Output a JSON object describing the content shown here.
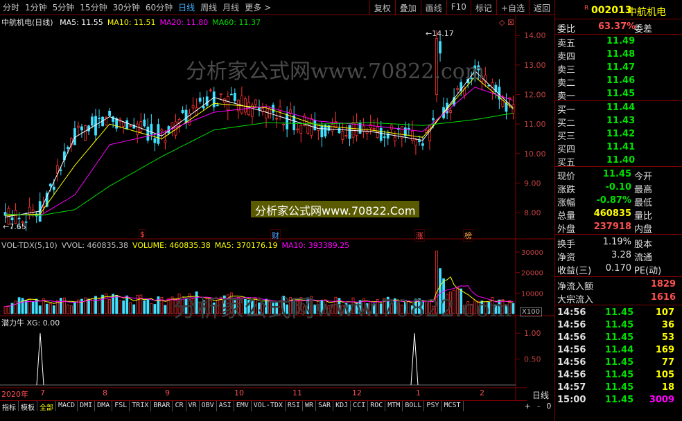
{
  "toolbar": {
    "timeframes": [
      "分时",
      "1分钟",
      "5分钟",
      "15分钟",
      "30分钟",
      "60分钟",
      "日线",
      "周线",
      "月线",
      "更多"
    ],
    "active": "日线",
    "more_arrow": ">",
    "right_buttons": [
      "复权",
      "叠加",
      "画线",
      "F10",
      "标记",
      "+自选",
      "返回"
    ]
  },
  "stock": {
    "badge": "R",
    "code": "002013",
    "name": "中航机电"
  },
  "main_chart": {
    "legend_title": "中航机电(日线)",
    "ma": [
      {
        "label": "MA5: 11.55",
        "color": "#ffffff"
      },
      {
        "label": "MA10: 11.51",
        "color": "#ffff00"
      },
      {
        "label": "MA20: 11.80",
        "color": "#ff00ff"
      },
      {
        "label": "MA60: 11.37",
        "color": "#00e000"
      }
    ],
    "high_label": "14.17",
    "low_label": "7.65",
    "diamonds": "◇ ☒",
    "events": [
      {
        "label": "$",
        "color": "#ff4040"
      },
      {
        "label": "财",
        "color": "#4aa0ff"
      },
      {
        "label": "涨",
        "color": "#ff4040"
      },
      {
        "label": "榜",
        "color": "#ffa040"
      }
    ]
  },
  "watermark": {
    "main": "分析家公式网www.70822.com",
    "badge": "分析家公式网www.70822.Com"
  },
  "vol_chart": {
    "legend": [
      {
        "label": "VOL-TDX(5,10)",
        "color": "#c0c0c0"
      },
      {
        "label": "VVOL: 460835.38",
        "color": "#c0c0c0"
      },
      {
        "label": "VOLUME: 460835.38",
        "color": "#ffff00"
      },
      {
        "label": "MA5: 370176.19",
        "color": "#ffff00"
      },
      {
        "label": "MA10: 393389.25",
        "color": "#ff00ff"
      }
    ],
    "scale_tag": "X100"
  },
  "ind_chart": {
    "legend": "潜力牛  XG: 0.00"
  },
  "date_axis": {
    "year_label": "2020年",
    "month_labels": [
      "7",
      "8",
      "9",
      "10",
      "11",
      "12",
      "1",
      "2"
    ]
  },
  "bottom_tabs": [
    "指标",
    "模板",
    "全部",
    "MACD",
    "DMI",
    "DMA",
    "FSL",
    "TRIX",
    "BRAR",
    "CR",
    "VR",
    "OBV",
    "ASI",
    "EMV",
    "VOL-TDX",
    "RSI",
    "WR",
    "SAR",
    "KDJ",
    "CCI",
    "ROC",
    "MTM",
    "BOLL",
    "PSY",
    "MCST"
  ],
  "bottom_active": "全部",
  "period_label": "日线",
  "bottom_controls": [
    "+",
    "-",
    "0"
  ],
  "order_book": {
    "ratio": {
      "label": "委比",
      "value": "63.37%",
      "label2": "委差"
    },
    "asks": [
      {
        "label": "卖五",
        "price": "11.49"
      },
      {
        "label": "卖四",
        "price": "11.48"
      },
      {
        "label": "卖三",
        "price": "11.47"
      },
      {
        "label": "卖二",
        "price": "11.46"
      },
      {
        "label": "卖一",
        "price": "11.45"
      }
    ],
    "bids": [
      {
        "label": "买一",
        "price": "11.44"
      },
      {
        "label": "买二",
        "price": "11.43"
      },
      {
        "label": "买三",
        "price": "11.42"
      },
      {
        "label": "买四",
        "price": "11.41"
      },
      {
        "label": "买五",
        "price": "11.40"
      }
    ]
  },
  "quote": [
    {
      "label": "现价",
      "value": "11.45",
      "label2": "今开",
      "color": "#00e000"
    },
    {
      "label": "涨跌",
      "value": "-0.10",
      "label2": "最高",
      "color": "#00e000"
    },
    {
      "label": "涨幅",
      "value": "-0.87%",
      "label2": "最低",
      "color": "#00e000"
    },
    {
      "label": "总量",
      "value": "460835",
      "label2": "量比",
      "color": "#ffff00"
    },
    {
      "label": "外盘",
      "value": "237918",
      "label2": "内盘",
      "color": "#ff5050"
    }
  ],
  "stats": [
    {
      "label": "换手",
      "value": "1.19%",
      "label2": "股本"
    },
    {
      "label": "净资",
      "value": "3.28",
      "label2": "流通"
    },
    {
      "label": "收益(三)",
      "value": "0.170",
      "label2": "PE(动)"
    }
  ],
  "flows": [
    {
      "label": "净流入额",
      "value": "1829"
    },
    {
      "label": "大宗流入",
      "value": "1616"
    }
  ],
  "ticks": [
    {
      "time": "14:56",
      "price": "11.45",
      "vol": "107",
      "vcolor": "#ffff00"
    },
    {
      "time": "14:56",
      "price": "11.45",
      "vol": "36",
      "vcolor": "#ffff00"
    },
    {
      "time": "14:56",
      "price": "11.45",
      "vol": "53",
      "vcolor": "#ffff00"
    },
    {
      "time": "14:56",
      "price": "11.44",
      "vol": "169",
      "vcolor": "#ffff00"
    },
    {
      "time": "14:56",
      "price": "11.45",
      "vol": "77",
      "vcolor": "#ffff00"
    },
    {
      "time": "14:56",
      "price": "11.45",
      "vol": "105",
      "vcolor": "#ffff00"
    },
    {
      "time": "14:57",
      "price": "11.45",
      "vol": "18",
      "vcolor": "#ffff00"
    },
    {
      "time": "15:00",
      "price": "11.45",
      "vol": "3009",
      "vcolor": "#ff00ff"
    }
  ],
  "chart_data": [
    {
      "type": "candlestick",
      "title": "中航机电(日线)",
      "y_axis_ticks": [
        "8.00",
        "9.00",
        "10.00",
        "11.00",
        "12.00",
        "13.00",
        "14.00"
      ],
      "ylim": [
        7.4,
        14.6
      ],
      "grid": false,
      "annotations": [
        "14.17",
        "7.65"
      ],
      "series": [
        {
          "name": "MA5",
          "color": "#ffffff",
          "x": [
            0,
            10,
            20,
            30,
            45,
            60,
            75,
            90,
            105,
            120,
            135,
            146
          ],
          "y": [
            7.85,
            8.05,
            10.55,
            11.25,
            10.6,
            11.9,
            11.4,
            10.85,
            10.75,
            10.45,
            12.8,
            11.55
          ]
        },
        {
          "name": "MA10",
          "color": "#ffff00",
          "x": [
            0,
            10,
            20,
            30,
            45,
            60,
            75,
            90,
            105,
            120,
            135,
            146
          ],
          "y": [
            7.9,
            7.95,
            9.6,
            11.0,
            10.5,
            11.7,
            11.55,
            10.95,
            10.8,
            10.55,
            12.6,
            11.51
          ]
        },
        {
          "name": "MA20",
          "color": "#ff00ff",
          "x": [
            0,
            10,
            20,
            30,
            45,
            60,
            75,
            90,
            105,
            120,
            135,
            146
          ],
          "y": [
            7.95,
            7.9,
            8.6,
            10.3,
            10.7,
            11.4,
            11.6,
            11.1,
            10.95,
            10.75,
            12.25,
            11.8
          ]
        },
        {
          "name": "MA60",
          "color": "#00e000",
          "x": [
            0,
            10,
            20,
            30,
            45,
            60,
            75,
            90,
            105,
            120,
            135,
            146
          ],
          "y": [
            7.95,
            7.9,
            8.1,
            8.9,
            9.9,
            10.8,
            11.05,
            11.0,
            11.05,
            10.95,
            11.15,
            11.37
          ]
        }
      ]
    },
    {
      "type": "bar",
      "title": "VOL-TDX(5,10)",
      "y_axis_ticks": [
        "10000",
        "20000",
        "30000"
      ],
      "ylim": [
        0,
        32000
      ],
      "scale": "X100"
    },
    {
      "type": "line",
      "title": "潜力牛",
      "y_axis_ticks": [
        "0.50",
        "1.00"
      ],
      "ylim": [
        0,
        1.15
      ],
      "series": [
        {
          "name": "XG",
          "spikes": [
            "7",
            "1"
          ],
          "values": [
            1,
            1
          ]
        }
      ]
    }
  ]
}
